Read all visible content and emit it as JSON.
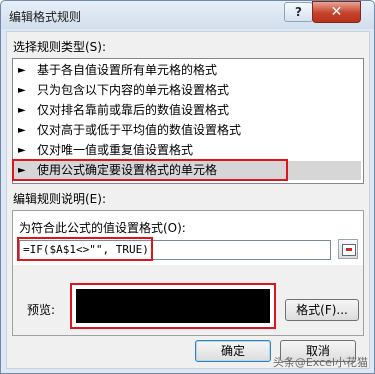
{
  "window": {
    "title": "编辑格式规则",
    "help_label": "?",
    "close_label": "✕"
  },
  "rule_type": {
    "label": "选择规则类型(S):",
    "items": [
      {
        "label": "基于各自值设置所有单元格的格式"
      },
      {
        "label": "只为包含以下内容的单元格设置格式"
      },
      {
        "label": "仅对排名靠前或靠后的数值设置格式"
      },
      {
        "label": "仅对高于或低于平均值的数值设置格式"
      },
      {
        "label": "仅对唯一值或重复值设置格式"
      },
      {
        "label": "使用公式确定要设置格式的单元格"
      }
    ],
    "selected_index": 5,
    "bullet": "►"
  },
  "rule_desc": {
    "label": "编辑规则说明(E):",
    "formula_label": "为符合此公式的值设置格式(O):",
    "formula_value": "=IF($A$1<>\"\", TRUE)",
    "preview_label": "预览:",
    "preview_fill_color": "#000000",
    "format_button": "格式(F)..."
  },
  "buttons": {
    "ok": "确定",
    "cancel": "取消"
  },
  "watermark": "头条@Excel小花猫",
  "colors": {
    "highlight_border": "#e0141e",
    "close_button": "#c5432b"
  }
}
